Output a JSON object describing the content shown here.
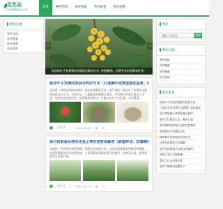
{
  "site": {
    "logo_title": "花艺谷",
    "logo_sub": "yangHuaGu.cn"
  },
  "nav": {
    "items": [
      "首页",
      "养护百科",
      "花卉图鉴",
      "花卉病害",
      "花卉品种"
    ],
    "active_index": 0
  },
  "left_sidebar": {
    "title": "网站分类",
    "items": [
      "养护百科",
      "花卉图鉴",
      "花卉病害",
      "花卉品种"
    ]
  },
  "hero": {
    "caption": "桂花树叶子发黄落叶的原因及解决方法（附图解答，治理不及时会影响开花）"
  },
  "articles": [
    {
      "title": "桂花叶子发黄的原因与养护方法（打造黄叶观赏型桂花盆景，都需要！）",
      "excerpt": "桂花是一种常见的绿化树种，每年秋季都会开花，香气浓郁。桂花叶子发黄的主要原因有浇水不当、光照不足、土壤碱化和施肥过量等。平时养护时要注意见干见湿，保证充足的散射光，定期施用矾肥水，才能让桂花生长旺盛，开花繁茂。",
      "author": "花艺谷",
      "date": "2021-06-16",
      "views": "10"
    },
    {
      "title": "探讨石斛是水养好还是土养好更容易栽培（家庭养法、防腐病有点意想不到！）",
      "excerpt": "石斛是一种名贵的观赏植物，既能水培也能土培。水培石斛需要选择健壮的植株，定期更换清水并添加营养液；土培则要选用疏松透气的基质，控制浇水量，避免根部积水导致烂根。",
      "author": "花艺谷",
      "date": "2021-06-16",
      "views": "12"
    }
  ],
  "right_sidebar": {
    "search_title": "搜索",
    "search_placeholder": "请输入关键词",
    "search_button": "搜索",
    "category_title": "网站分类",
    "category_items": [
      "养护百科",
      "花卉图鉴",
      "花卉病害",
      "花卉品种"
    ],
    "latest_title": "最近发表",
    "latest_items": [
      "桂花叶子发黄的原因与养护方法",
      "一品红不开花是什么原因？如何催花",
      "探讨石斛是水养好还是土养好",
      "君子兰烂根怎么办，教你几招",
      "多肉植物的养殖方法和注意事项",
      "发财树叶子发黄怎么办",
      "绿萝黄叶的原因及处理方法",
      "月季花的修剪方法图解",
      "栀子花的养殖方法和注意事项",
      "虎皮兰怎么分株繁殖",
      "君子兰什么时候开花",
      "怎样了解是否枯萎死了"
    ]
  },
  "colors": {
    "accent": "#2aa85f",
    "link": "#2a6ab5"
  }
}
